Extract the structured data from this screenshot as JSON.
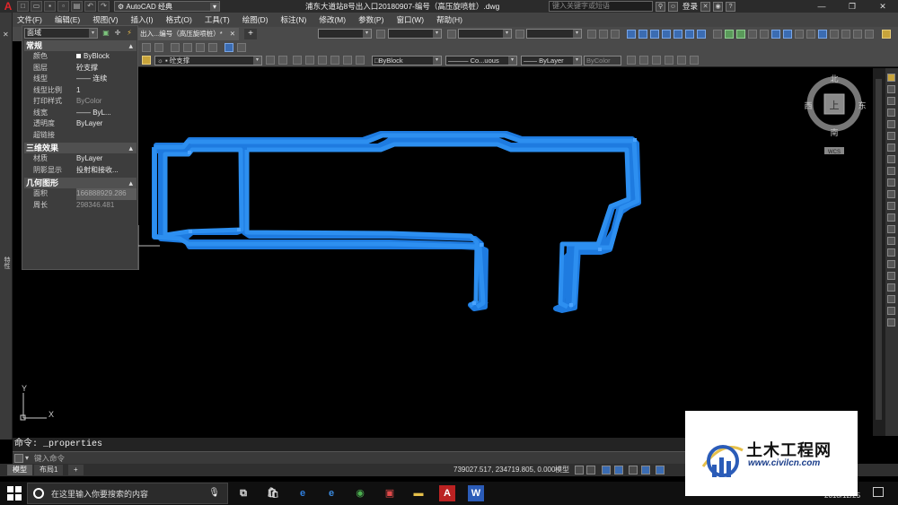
{
  "titlebar": {
    "app_logo": "A",
    "workspace": "AutoCAD 经典",
    "document_title": "浦东大道站8号出入口20180907-编号（高压旋喷桩）.dwg",
    "search_placeholder": "键入关键字或短语",
    "login": "登录"
  },
  "menubar": {
    "items": [
      "文件(F)",
      "编辑(E)",
      "视图(V)",
      "插入(I)",
      "格式(O)",
      "工具(T)",
      "绘图(D)",
      "标注(N)",
      "修改(M)",
      "参数(P)",
      "窗口(W)",
      "帮助(H)"
    ]
  },
  "file_tab": {
    "label": "出入...编号（高压旋喷桩）*"
  },
  "toolbar": {
    "layer_value": "砼支撑",
    "color_value": "ByBlock",
    "linetype_value": "Co...uous",
    "lineweight_value": "ByLayer",
    "plotstyle_value": "ByColor"
  },
  "properties": {
    "selection": "面域",
    "sections": {
      "general": "常规",
      "three_d": "三维效果",
      "geometry": "几何图形"
    },
    "general_rows": [
      {
        "key": "颜色",
        "value": "ByBlock"
      },
      {
        "key": "图层",
        "value": "砼支撑"
      },
      {
        "key": "线型",
        "value": "—— 连续"
      },
      {
        "key": "线型比例",
        "value": "1"
      },
      {
        "key": "打印样式",
        "value": "ByColor"
      },
      {
        "key": "线宽",
        "value": "—— ByL..."
      },
      {
        "key": "透明度",
        "value": "ByLayer"
      },
      {
        "key": "超链接",
        "value": ""
      }
    ],
    "three_d_rows": [
      {
        "key": "材质",
        "value": "ByLayer"
      },
      {
        "key": "阴影显示",
        "value": "投射和接收..."
      }
    ],
    "geometry_rows": [
      {
        "key": "面积",
        "value": "166888929.286"
      },
      {
        "key": "周长",
        "value": "298346.481"
      }
    ],
    "side_label": "特性"
  },
  "viewcube": {
    "north": "北",
    "south": "南",
    "east": "东",
    "west": "西",
    "top": "上",
    "wcs": "WCS"
  },
  "ucs": {
    "x": "X",
    "y": "Y"
  },
  "command": {
    "history": "命令: _properties",
    "placeholder": "键入命令"
  },
  "layout_tabs": [
    "模型",
    "布局1"
  ],
  "status": {
    "coords": "739027.517, 234719.805, 0.000",
    "model": "模型"
  },
  "taskbar": {
    "search_placeholder": "在这里输入你要搜索的内容",
    "date": "2018/12/25"
  },
  "watermark": {
    "title": "土木工程网",
    "url": "www.civilcn.com"
  },
  "colors": {
    "selection_blue": "#1e7be0",
    "canvas": "#000000",
    "autocad_red": "#e0262b"
  }
}
